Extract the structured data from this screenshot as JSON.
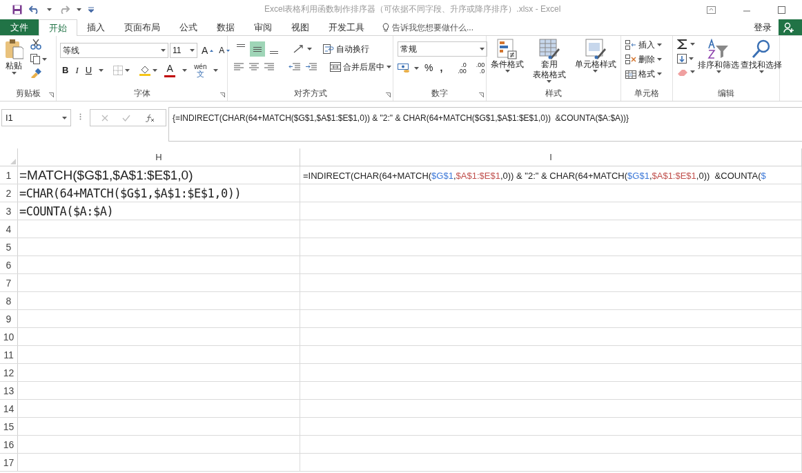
{
  "title_bar": {
    "title": "Excel表格利用函数制作排序器（可依据不同字段、升序或降序排序）.xlsx - Excel"
  },
  "ribbon_tabs": [
    {
      "label": "文件",
      "kind": "file",
      "selected": false
    },
    {
      "label": "开始",
      "kind": "tab",
      "selected": true
    },
    {
      "label": "插入",
      "kind": "tab",
      "selected": false
    },
    {
      "label": "页面布局",
      "kind": "tab",
      "selected": false
    },
    {
      "label": "公式",
      "kind": "tab",
      "selected": false
    },
    {
      "label": "数据",
      "kind": "tab",
      "selected": false
    },
    {
      "label": "审阅",
      "kind": "tab",
      "selected": false
    },
    {
      "label": "视图",
      "kind": "tab",
      "selected": false
    },
    {
      "label": "开发工具",
      "kind": "tab",
      "selected": false
    }
  ],
  "tell_me": {
    "placeholder": "告诉我您想要做什么..."
  },
  "sign_in": "登录",
  "clipboard": {
    "label": "剪贴板",
    "paste": "粘贴"
  },
  "font": {
    "label": "字体",
    "font_name": "等线",
    "font_size": "11",
    "grow": "A",
    "shrink": "A",
    "bold": "B",
    "italic": "I",
    "underline": "U",
    "font_color": "A",
    "phonetic_top": "wén",
    "phonetic_bottom": "文"
  },
  "alignment": {
    "label": "对齐方式",
    "vertical": [
      {
        "selected": false
      },
      {
        "selected": true
      },
      {
        "selected": false
      }
    ],
    "wrap_text": "自动换行",
    "merge_center": "合并后居中"
  },
  "number": {
    "label": "数字",
    "format": "常规",
    "percent": "%",
    "comma": ",",
    "increase_decimal": [
      ".0",
      ".00"
    ],
    "decrease_decimal": [
      ".00",
      ".0"
    ]
  },
  "styles": {
    "label": "样式",
    "buttons": [
      [
        "条件格式"
      ],
      [
        "套用",
        "表格格式"
      ],
      [
        "单元格样式"
      ]
    ]
  },
  "cells": {
    "label": "单元格",
    "buttons": [
      "插入",
      "删除",
      "格式"
    ]
  },
  "editing": {
    "label": "编辑",
    "buttons": [
      "排序和筛选",
      "查找和选择"
    ]
  },
  "name_box": "I1",
  "formula": "{=INDIRECT(CHAR(64+MATCH($G$1,$A$1:$E$1,0)) & \"2:\" & CHAR(64+MATCH($G$1,$A$1:$E$1,0))  &COUNTA($A:$A))}",
  "columns": [
    {
      "label": "H"
    },
    {
      "label": "I"
    }
  ],
  "rows": [
    {
      "number": "1",
      "cells": [
        {
          "kind": "sans",
          "text": "=MATCH($G$1,$A$1:$E$1,0)"
        },
        {
          "kind": "edit",
          "segments": [
            {
              "text": "=INDIRECT(CHAR(64+MATCH("
            },
            {
              "text": "$G$1",
              "color": "#3c78d8"
            },
            {
              "text": ","
            },
            {
              "text": "$A$1:$E$1",
              "color": "#c0504d"
            },
            {
              "text": ",0)) & \"2:\" & CHAR(64+MATCH("
            },
            {
              "text": "$G$1",
              "color": "#3c78d8"
            },
            {
              "text": ","
            },
            {
              "text": "$A$1:$E$1",
              "color": "#c0504d"
            },
            {
              "text": ",0))  &COUNTA("
            },
            {
              "text": "$",
              "color": "#3c78d8"
            }
          ]
        }
      ]
    },
    {
      "number": "2",
      "cells": [
        {
          "kind": "mono",
          "text": "=CHAR(64+MATCH($G$1,$A$1:$E$1,0))"
        }
      ]
    },
    {
      "number": "3",
      "cells": [
        {
          "kind": "mono",
          "text": "=COUNTA($A:$A)"
        }
      ]
    },
    {
      "number": "4"
    },
    {
      "number": "5"
    },
    {
      "number": "6"
    },
    {
      "number": "7"
    },
    {
      "number": "8"
    },
    {
      "number": "9"
    },
    {
      "number": "10"
    },
    {
      "number": "11"
    },
    {
      "number": "12"
    },
    {
      "number": "13"
    },
    {
      "number": "14"
    },
    {
      "number": "15"
    },
    {
      "number": "16"
    },
    {
      "number": "17"
    }
  ]
}
